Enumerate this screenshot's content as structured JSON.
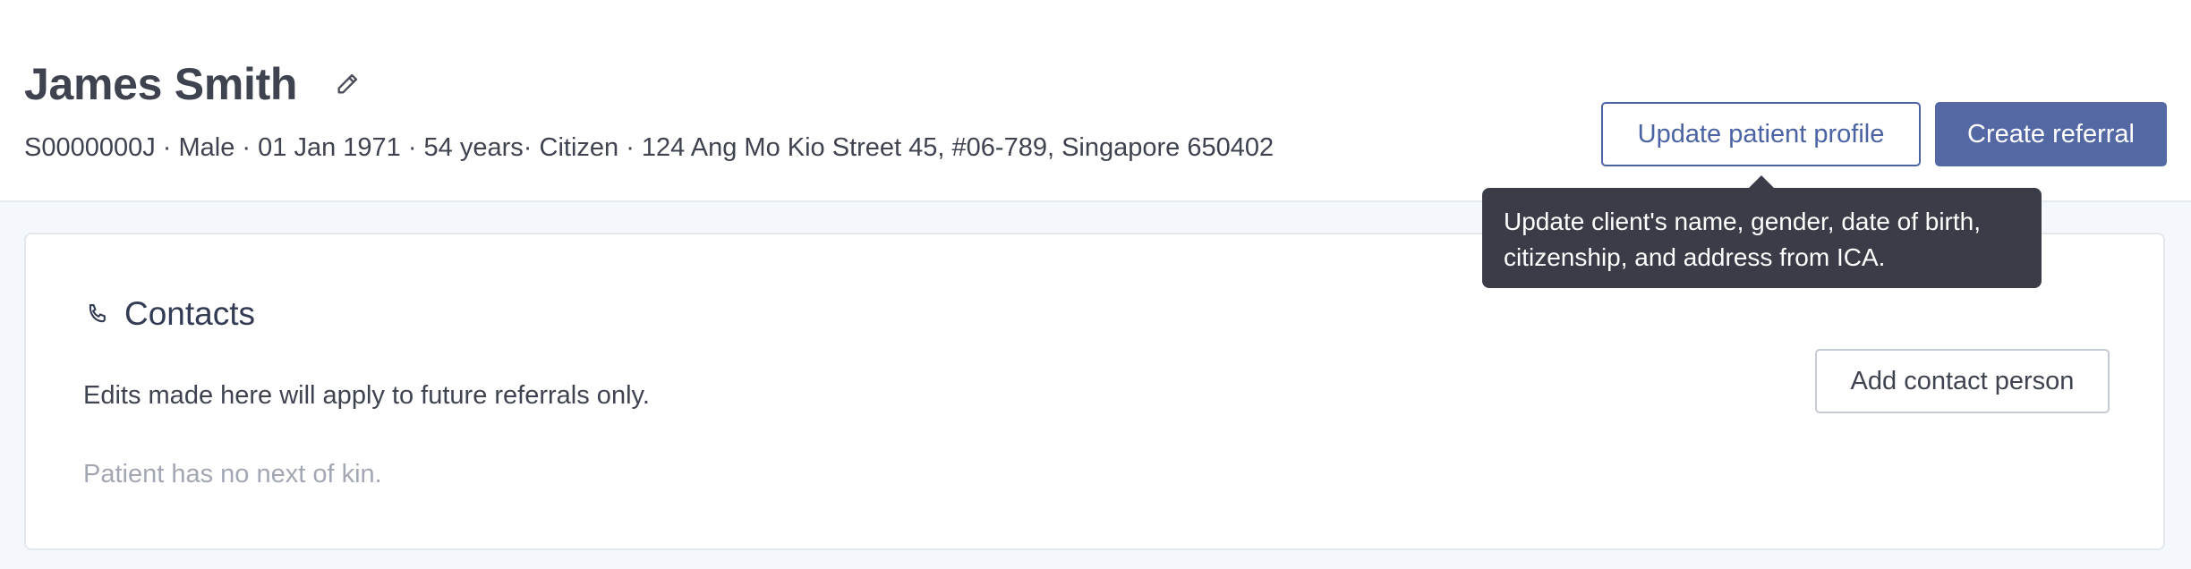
{
  "patient": {
    "name": "James Smith",
    "meta": "S0000000J · Male · 01 Jan 1971 · 54 years· Citizen · 124 Ang Mo Kio Street 45, #06-789, Singapore 650402"
  },
  "actions": {
    "update_profile_label": "Update patient profile",
    "create_referral_label": "Create referral"
  },
  "tooltip": {
    "line1": "Update client's name, gender, date of birth,",
    "line2": "citizenship, and address from ICA."
  },
  "contacts": {
    "title": "Contacts",
    "note": "Edits made here will apply to future referrals only.",
    "empty_text": "Patient has no next of kin.",
    "add_label": "Add contact person"
  },
  "colors": {
    "primary": "#5468a4",
    "tooltip_bg": "#3a3d47",
    "page_bg": "#f4f7fb"
  },
  "icons": {
    "edit": "pencil-icon",
    "contacts": "phone-icon"
  }
}
